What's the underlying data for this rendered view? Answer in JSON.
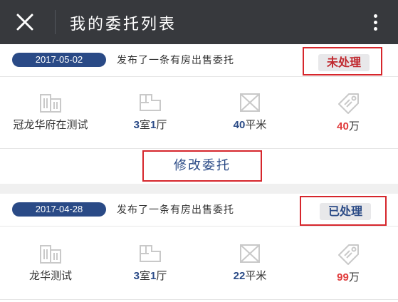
{
  "header": {
    "title": "我的委托列表",
    "close_icon": "close-icon",
    "menu_icon": "more-vertical-icon"
  },
  "colors": {
    "header_bg": "#37393d",
    "date_pill": "#2a4a86",
    "accent_red": "#d6262c",
    "price_red": "#e03c3c"
  },
  "listings": [
    {
      "date": "2017-05-02",
      "description": "发布了一条有房出售委托",
      "status": "未处理",
      "status_color": "#c0282e",
      "name": "冠龙华府在测试",
      "layout_num_room": "3",
      "layout_room": "室",
      "layout_num_hall": "1",
      "layout_hall": "厅",
      "area_num": "40",
      "area_unit": "平米",
      "price_num": "40",
      "price_unit": "万",
      "modify_label": "修改委托"
    },
    {
      "date": "2017-04-28",
      "description": "发布了一条有房出售委托",
      "status": "已处理",
      "status_color": "#2a4a86",
      "name": "龙华测试",
      "layout_num_room": "3",
      "layout_room": "室",
      "layout_num_hall": "1",
      "layout_hall": "厅",
      "area_num": "22",
      "area_unit": "平米",
      "price_num": "99",
      "price_unit": "万"
    }
  ]
}
